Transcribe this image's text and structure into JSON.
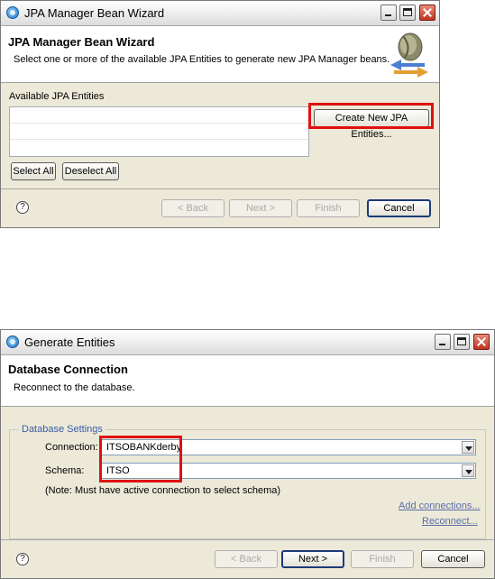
{
  "dialog1": {
    "window_title": "JPA Manager Bean Wizard",
    "header_title": "JPA Manager Bean Wizard",
    "header_description": "Select one or more of the available JPA Entities to generate new JPA Manager beans.",
    "entities_label": "Available JPA Entities",
    "create_button": "Create New JPA Entities...",
    "select_all": "Select All",
    "deselect_all": "Deselect All",
    "help": "?",
    "back": "< Back",
    "next": "Next >",
    "finish": "Finish",
    "cancel": "Cancel"
  },
  "dialog2": {
    "window_title": "Generate Entities",
    "header_title": "Database Connection",
    "header_description": "Reconnect to the database.",
    "group_title": "Database Settings",
    "connection_label": "Connection:",
    "connection_value": "ITSOBANKderby",
    "schema_label": "Schema:",
    "schema_value": "ITSO",
    "note": "(Note:  Must have active connection to select schema)",
    "add_connections": "Add connections...",
    "reconnect": "Reconnect...",
    "help": "?",
    "back": "< Back",
    "next": "Next >",
    "finish": "Finish",
    "cancel": "Cancel"
  },
  "colors": {
    "highlight": "#e01010",
    "link": "#5a6fa6",
    "group_title": "#3a5da8",
    "dialog_bg": "#ece9d8"
  },
  "icons": {
    "app": "eclipse-globe-icon",
    "banner": "coffee-bean-arrows-icon"
  }
}
